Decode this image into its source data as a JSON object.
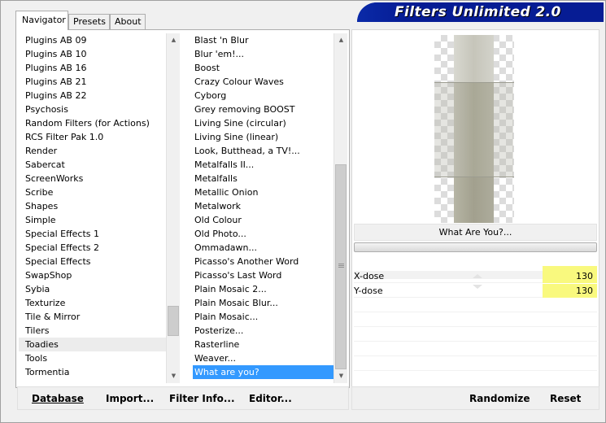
{
  "window": {
    "title": "Filters Unlimited 2.0"
  },
  "tabs": [
    {
      "label": "Navigator",
      "active": true
    },
    {
      "label": "Presets",
      "active": false
    },
    {
      "label": "About",
      "active": false
    }
  ],
  "categories": {
    "items": [
      "Plugins AB 09",
      "Plugins AB 10",
      "Plugins AB 16",
      "Plugins AB 21",
      "Plugins AB 22",
      "Psychosis",
      "Random Filters (for Actions)",
      "RCS Filter Pak 1.0",
      "Render",
      "Sabercat",
      "ScreenWorks",
      "Scribe",
      "Shapes",
      "Simple",
      "Special Effects 1",
      "Special Effects 2",
      "Special Effects",
      "SwapShop",
      "Sybia",
      "Texturize",
      "Tile & Mirror",
      "Tilers",
      "Toadies",
      "Tools",
      "Tormentia"
    ],
    "hovered": "Toadies"
  },
  "filters": {
    "items": [
      "Blast 'n Blur",
      "Blur 'em!...",
      "Boost",
      "Crazy Colour Waves",
      "Cyborg",
      "Grey removing BOOST",
      "Living Sine (circular)",
      "Living Sine (linear)",
      "Look, Butthead, a TV!...",
      "Metalfalls II...",
      "Metalfalls",
      "Metallic Onion",
      "Metalwork",
      "Old Colour",
      "Old Photo...",
      "Ommadawn...",
      "Picasso's Another Word",
      "Picasso's Last Word",
      "Plain Mosaic 2...",
      "Plain Mosaic Blur...",
      "Plain Mosaic...",
      "Posterize...",
      "Rasterline",
      "Weaver...",
      "What are you?"
    ],
    "selected": "What are you?"
  },
  "buttons": {
    "database": "Database",
    "import": "Import...",
    "filter_info": "Filter Info...",
    "editor": "Editor...",
    "randomize": "Randomize",
    "reset": "Reset"
  },
  "preview": {
    "filter_name": "What Are You?..."
  },
  "params": [
    {
      "label": "X-dose",
      "value": "130"
    },
    {
      "label": "Y-dose",
      "value": "130"
    }
  ],
  "colors": {
    "banner": "#061c94",
    "selection": "#3399ff",
    "param_highlight": "#f9f97e"
  }
}
